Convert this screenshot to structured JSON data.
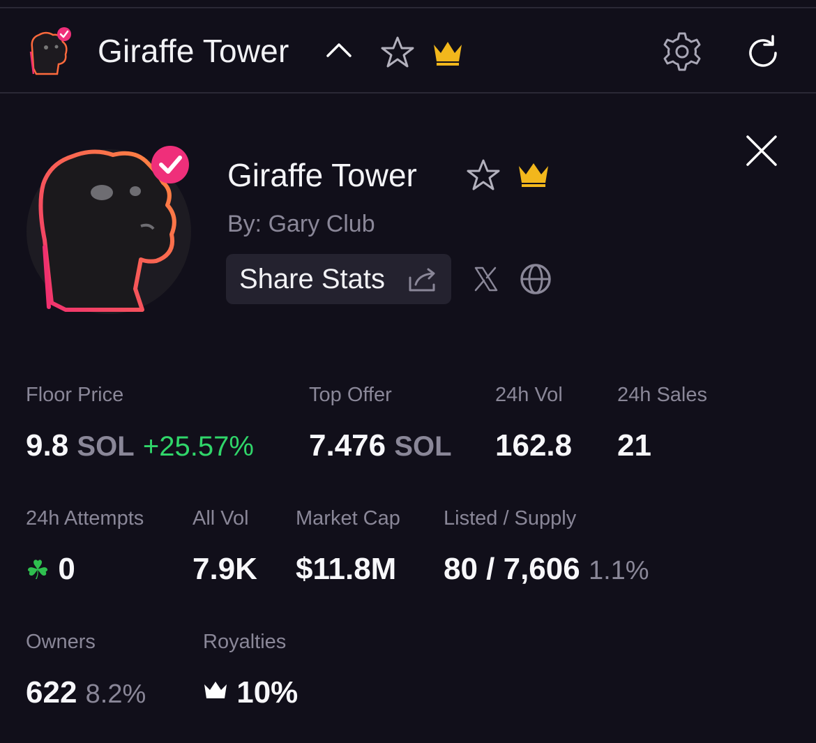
{
  "header": {
    "title": "Giraffe Tower",
    "icons": [
      "collection-avatar",
      "chevron-up-icon",
      "star-icon",
      "crown-icon",
      "gear-icon",
      "refresh-icon"
    ]
  },
  "profile": {
    "title": "Giraffe Tower",
    "by": "By: Gary Club",
    "share_label": "Share Stats",
    "verified": true
  },
  "stats": {
    "floor_price": {
      "label": "Floor Price",
      "value": "9.8",
      "unit": "SOL",
      "change": "+25.57%"
    },
    "top_offer": {
      "label": "Top Offer",
      "value": "7.476",
      "unit": "SOL"
    },
    "vol_24h": {
      "label": "24h Vol",
      "value": "162.8"
    },
    "sales_24h": {
      "label": "24h Sales",
      "value": "21"
    },
    "attempts_24h": {
      "label": "24h Attempts",
      "icon": "☘",
      "value": "0"
    },
    "all_vol": {
      "label": "All Vol",
      "value": "7.9K"
    },
    "market_cap": {
      "label": "Market Cap",
      "value": "$11.8M"
    },
    "listed_supply": {
      "label": "Listed / Supply",
      "value": "80 / 7,606",
      "percent": "1.1%"
    },
    "owners": {
      "label": "Owners",
      "value": "622",
      "percent": "8.2%"
    },
    "royalties": {
      "label": "Royalties",
      "value": "10%"
    }
  },
  "colors": {
    "background": "#110f1a",
    "accent_pink": "#ef2f7a",
    "crown_gold": "#f2b71c",
    "positive_green": "#30d66a",
    "muted_text": "#8a8798"
  }
}
